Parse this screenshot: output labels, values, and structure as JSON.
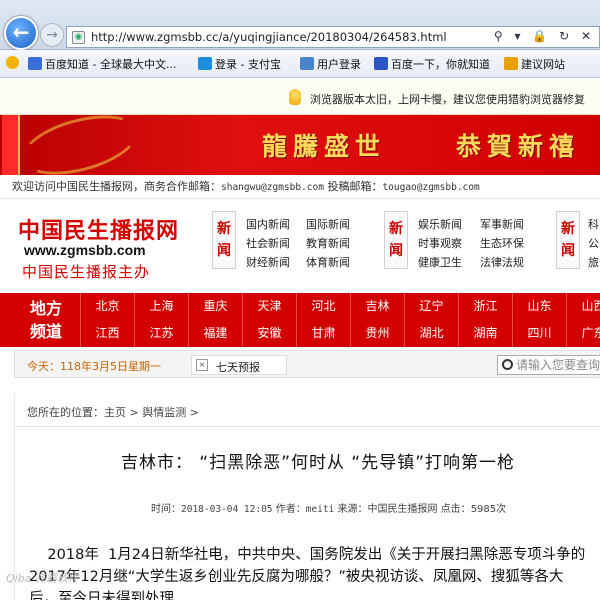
{
  "browser": {
    "url": "http://www.zgmsbb.cc/a/yuqingjiance/20180304/264583.html",
    "tools": "⚲ ▾ 🔒 ↻ ✕",
    "favorites": [
      {
        "label": "百度知道 - 全球最大中文...",
        "color": "#3b6fd8"
      },
      {
        "label": "登录 - 支付宝",
        "color": "#1c8fe0"
      },
      {
        "label": "用户登录",
        "color": "#4a84c8"
      },
      {
        "label": "百度一下，你就知道",
        "color": "#2b54c8"
      },
      {
        "label": "建议网站",
        "color": "#e6a000"
      }
    ],
    "notice": "浏览器版本太旧，上网卡慢，建议您使用猎豹浏览器修复"
  },
  "banner": {
    "left_text": "龍騰盛世",
    "right_text": "恭賀新禧"
  },
  "header": {
    "welcome_prefix": "欢迎访问中国民生播报网，商务合作邮箱：",
    "business_email": "shangwu@zgmsbb.com",
    "submit_label": " 投稿邮箱：",
    "submit_email": "tougao@zgmsbb.com",
    "logo_title": "中国民生播报网",
    "logo_url": "www.zgmsbb.com",
    "logo_subtitle": "中国民生播报主办"
  },
  "news_groups": [
    {
      "tag": "新闻",
      "col1": [
        "国内新闻",
        "社会新闻",
        "财经新闻"
      ],
      "col2": [
        "国际新闻",
        "教育新闻",
        "体育新闻"
      ]
    },
    {
      "tag": "新闻",
      "col1": [
        "娱乐新闻",
        "时事观察",
        "健康卫生"
      ],
      "col2": [
        "军事新闻",
        "生态环保",
        "法律法规"
      ]
    },
    {
      "tag": "新闻",
      "col1": [
        "科",
        "公",
        "旅"
      ],
      "col2": []
    }
  ],
  "region_nav": {
    "label_line1": "地方",
    "label_line2": "频道",
    "row1": [
      "北京",
      "上海",
      "重庆",
      "天津",
      "河北",
      "吉林",
      "辽宁",
      "浙江",
      "山东",
      "山西"
    ],
    "row2": [
      "江西",
      "江苏",
      "福建",
      "安徽",
      "甘肃",
      "贵州",
      "湖北",
      "湖南",
      "四川",
      "广东"
    ]
  },
  "date_bar": {
    "prefix": "今天：",
    "date": "118年3月5日星期一",
    "weather_label": "七天预报",
    "search_placeholder": "请输入您要查询"
  },
  "breadcrumb": {
    "prefix": "您所在的位置：",
    "home": "主页",
    "sep1": " > ",
    "category": "舆情监测",
    "sep2": " >"
  },
  "article": {
    "title": "吉林市：  “扫黑除恶”何时从 “先导镇”打响第一枪",
    "time_label": "时间：",
    "time": "2018-03-04 12:05",
    "author_label": " 作者：",
    "author": "meiti",
    "source_label": " 来源：",
    "source": "中国民生播报网",
    "clicks_label": " 点击：",
    "clicks": "5985次",
    "body_lines": [
      "    2018年  1月24日新华社电，中共中央、国务院发出《关于开展扫黑除恶专项斗争的",
      "2017年12月继“大学生返乡创业先反腐为哪般？”被央视访谈、凤凰网、搜狐等各大",
      "后，至今日未得到处理"
    ]
  },
  "watermark": "Qiba 齐霸软件"
}
